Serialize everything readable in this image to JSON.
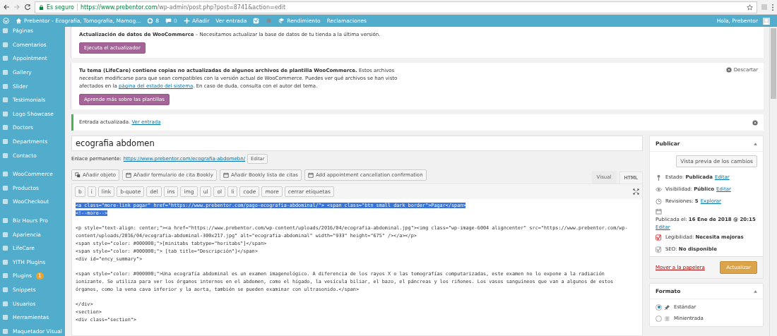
{
  "browser": {
    "security": "Es seguro",
    "url_domain": "https://www.prebentor.com",
    "url_path": "/wp-admin/post.php?post=8741&action=edit"
  },
  "admin_bar": {
    "site": "Prebentor - Ecografía, Tomografía, Mamog...",
    "updates": "8",
    "comments": "0",
    "add": "Añadir",
    "view": "Ver entrada",
    "performance": "Rendimiento",
    "claims": "Reclamaciones",
    "greeting": "Hola, Prebentor"
  },
  "sidebar": {
    "groups": [
      {
        "items": [
          {
            "label": "Páginas"
          },
          {
            "label": "Comentarios"
          },
          {
            "label": "Appointment"
          },
          {
            "label": "Gallery"
          },
          {
            "label": "Slider"
          },
          {
            "label": "Testimonials"
          },
          {
            "label": "Logo Showcase"
          },
          {
            "label": "Doctors"
          },
          {
            "label": "Departments"
          },
          {
            "label": "Contacto"
          }
        ]
      },
      {
        "items": [
          {
            "label": "WooCommerce"
          },
          {
            "label": "Productos"
          },
          {
            "label": "WooCheckout"
          }
        ]
      },
      {
        "items": [
          {
            "label": "Biz Hours Pro"
          },
          {
            "label": "Apariencia"
          },
          {
            "label": "LifeCare"
          },
          {
            "label": "YITH Plugins"
          },
          {
            "label": "Plugins",
            "badge": "1"
          },
          {
            "label": "Snippets"
          },
          {
            "label": "Usuarios"
          },
          {
            "label": "Herramientas"
          },
          {
            "label": "Maquetador Visual"
          }
        ]
      }
    ]
  },
  "notices": [
    {
      "kind": "update",
      "text": "**Actualización de datos de WooCommerce** – Necesitamos actualizar la base de datos de tu tienda a la última versión.",
      "button": "Ejecuta el actualizador"
    },
    {
      "kind": "templates",
      "text_before": "**Tu tema (LifeCare) contiene copias no actualizadas de algunos archivos de plantilla WooCommerce.** Estos archivos necesitan modificarse para que sean compatibles con la versión actual de WooCommerce. Puedes ver qué archivos se han visto afectados en la",
      "link": "página del estado del sistema",
      "text_after": ". En caso de duda, consulta con el autor del tema.",
      "button": "Aprende más sobre las plantillas",
      "dismiss": "Descartar"
    },
    {
      "kind": "success",
      "text": "Entrada actualizada.",
      "link": "Ver entrada"
    }
  ],
  "editor": {
    "title": "ecografia abdomen",
    "permalink_label": "Enlace permanente:",
    "permalink": "https://www.prebentor.com/ecografia-abdomebn/",
    "permalink_button": "Editar",
    "media_buttons": [
      "Añadir objeto",
      "Añadir formulario de cita Bookly",
      "Añadir Bookly lista de citas",
      "Add appointment cancellation confirmation"
    ],
    "tabs": [
      {
        "label": "Visual",
        "selected": false
      },
      {
        "label": "HTML",
        "selected": true
      }
    ],
    "quicktags": [
      "b",
      "i",
      "link",
      "b-quote",
      "del",
      "ins",
      "img",
      "ul",
      "ol",
      "li",
      "code",
      "more",
      "cerrar etiquetas"
    ],
    "code_blocks": [
      {
        "selected": true,
        "lines": [
          "<a class=\"more-link pagar\" href=\"https://www.prebentor.com/pago-ecografia-abdominal/\"> <span class=\"btn small dark border\">Pagar</span>",
          "<!--more-->"
        ]
      },
      {
        "selected": false,
        "lines": [
          "<p style=\"text-align: center;\"><a href=\"https://www.prebentor.com/wp-content/uploads/2016/04/ecografia-abdominal.jpg\"><img class=\"wp-image-6004 aligncenter\" src=\"https://www.prebentor.com/wp-",
          "content/uploads/2016/04/ecografia-abdominal-300x217.jpg\" alt=\"ecografia-abdominal\" width=\"933\" height=\"675\" /></a></p>",
          "<span style=\"color: #000000;\">[minitabs tabtype=\"horitabs\"]</span>",
          "<span style=\"color: #000000;\"> [tab title=\"Descripción\"]</span>",
          "<div id=\"ency_summary\">"
        ]
      },
      {
        "selected": false,
        "lines": [
          "<span style=\"color: #000000;\">Una ecografía abdominal es un examen imagenológico. A diferencia de los rayos X o las tomografías computarizadas, este examen no lo expone a la radiación",
          "ionizante. Se utiliza para ver los órganos internos en el abdomen, como el hígado, la vesícula biliar, el bazo, el páncreas y los riñones. Los vasos sanguíneos que van a algunos de estos",
          "órganos, como la vena cava inferior y la aorta, también se pueden examinar con ultrasonido.</span>"
        ]
      },
      {
        "selected": false,
        "lines": [
          "</div>",
          "<section>",
          "<div class=\"section\">"
        ]
      }
    ]
  },
  "publish": {
    "title": "Publicar",
    "preview": "Vista previa de los cambios",
    "rows": [
      {
        "kind": "status",
        "label": "Estado:",
        "value": "Publicada",
        "link": "Editar"
      },
      {
        "kind": "visibility",
        "label": "Visibilidad:",
        "value": "Público",
        "link": "Editar"
      },
      {
        "kind": "revisions",
        "label": "Revisiones:",
        "value": "5",
        "link": "Explorar"
      },
      {
        "kind": "date",
        "label": "Publicada el:",
        "value": "16 Ene de 2018 @ 20:15",
        "link": "Editar"
      },
      {
        "kind": "readability",
        "label": "Legibilidad:",
        "value": "Necesita mejoras"
      },
      {
        "kind": "seo",
        "label": "SEO:",
        "value": "No disponible"
      }
    ],
    "trash": "Mover a la papelera",
    "update": "Actualizar"
  },
  "format": {
    "title": "Formato",
    "options": [
      {
        "label": "Estándar",
        "selected": true
      },
      {
        "label": "Minientrada",
        "selected": false
      }
    ]
  }
}
